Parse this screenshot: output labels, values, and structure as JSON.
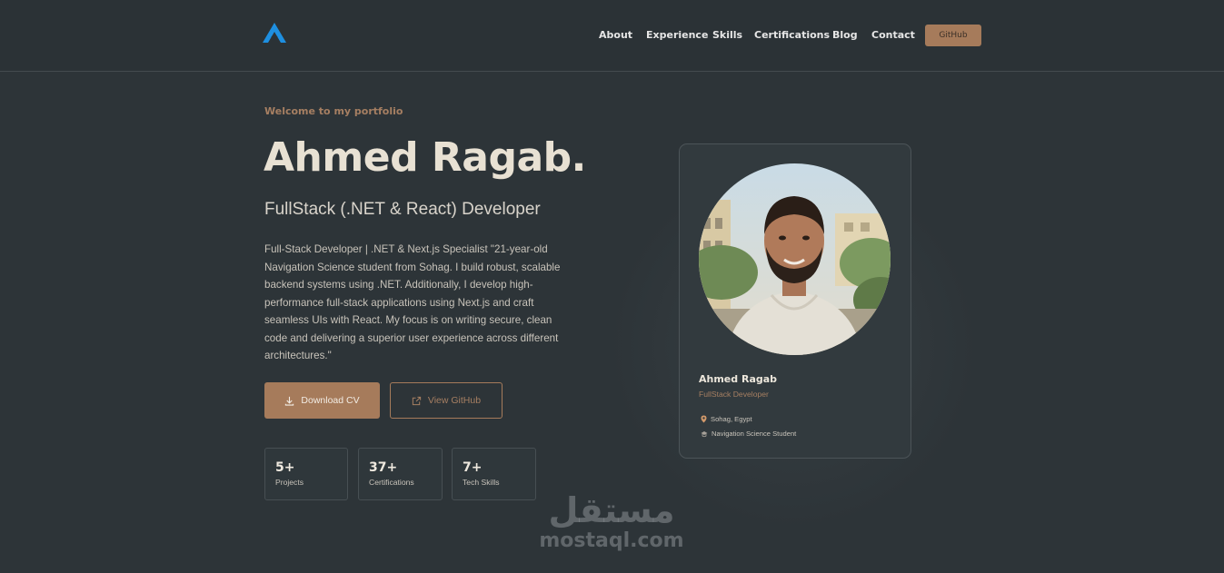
{
  "nav": {
    "items": [
      "About",
      "Experience",
      "Skills",
      "Certifications",
      "Blog",
      "Contact"
    ],
    "github_label": "GitHub"
  },
  "hero": {
    "welcome": "Welcome to my portfolio",
    "name": "Ahmed Ragab.",
    "role": "FullStack (.NET & React) Developer",
    "bio": "Full-Stack Developer | .NET & Next.js Specialist \"21-year-old Navigation Science student from Sohag. I build robust, scalable backend systems using .NET. Additionally, I develop high-performance full-stack applications using Next.js and craft seamless UIs with React. My focus is on writing secure, clean code and delivering a superior user experience across different architectures.\"",
    "download_label": "Download CV",
    "github_label": "View GitHub"
  },
  "stats": [
    {
      "value": "5+",
      "label": "Projects"
    },
    {
      "value": "37+",
      "label": "Certifications"
    },
    {
      "value": "7+",
      "label": "Tech Skills"
    }
  ],
  "card": {
    "name": "Ahmed Ragab",
    "role": "FullStack Developer",
    "location": "Sohag, Egypt",
    "education": "Navigation Science Student"
  },
  "watermark": {
    "arabic": "مستقل",
    "latin": "mostaql.com"
  },
  "colors": {
    "background": "#2d3438",
    "accent": "#a67b5b",
    "logo": "#1e8fe0"
  }
}
